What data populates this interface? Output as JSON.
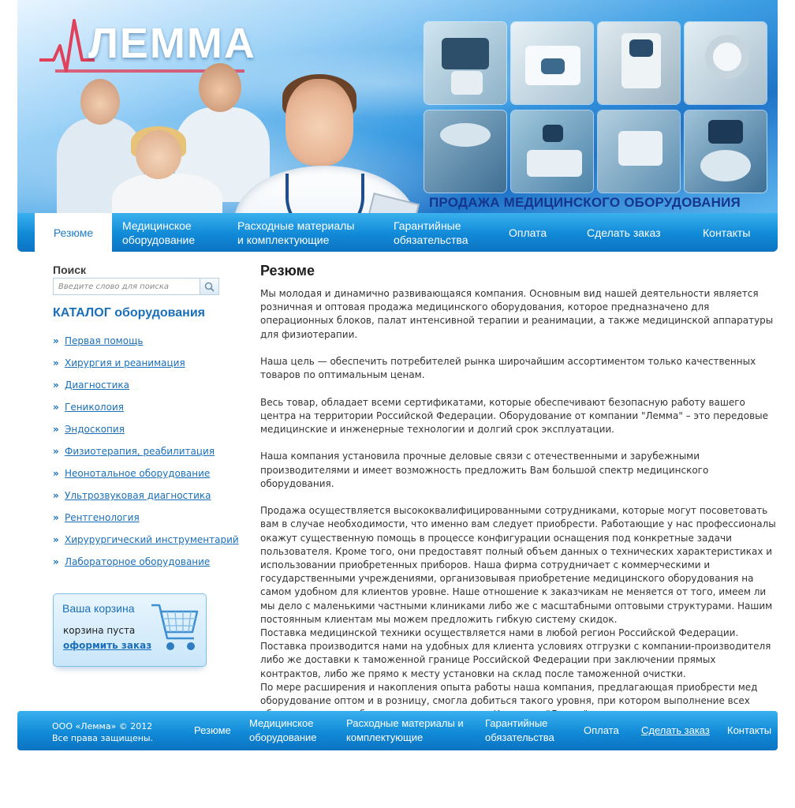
{
  "header": {
    "logo_text": "ЛЕММА",
    "tagline": "ПРОДАЖА МЕДИЦИНСКОГО ОБОРУДОВАНИЯ"
  },
  "nav": {
    "items": [
      {
        "label": "Резюме",
        "active": true
      },
      {
        "label": "Медицинское\nоборудование"
      },
      {
        "label": "Расходные материалы\nи комплектующие"
      },
      {
        "label": "Гарантийные\nобязательства"
      },
      {
        "label": "Оплата"
      },
      {
        "label": "Сделать заказ"
      },
      {
        "label": "Контакты"
      }
    ]
  },
  "sidebar": {
    "search_title": "Поиск",
    "search_placeholder": "Введите слово для поиска",
    "catalog_title": "КАТАЛОГ оборудования",
    "catalog_items": [
      "Первая помощь",
      "Хирургия и реанимация",
      "Диагностика",
      "Гениколоия",
      "Эндоскопия",
      "Физиотерапия, реабилитация",
      "Неонотальное оборудование",
      "Ультрозвуковая диагностика",
      "Рентгенология",
      "Хирурургический инструментарий",
      "Лабораторное оборудование"
    ],
    "cart": {
      "title": "Ваша корзина",
      "status": "корзина пуста",
      "order_link": "оформить заказ"
    }
  },
  "content": {
    "title": "Резюме",
    "paragraphs": [
      "Мы молодая и динамично развивающаяся компания. Основным вид нашей деятельности является розничная и оптовая продажа медицинского оборудования, которое предназначено для операционных блоков, палат интенсивной терапии и реанимации, а также медицинской аппаратуры для физиотерапии.",
      "Наша цель — обеспечить потребителей рынка широчайшим ассортиментом только качественных товаров по оптимальным ценам.",
      "Весь товар, обладает всеми сертификатами, которые обеспечивают безопасную работу вашего центра на территории Российской Федерации. Оборудование от компании \"Лемма\" – это передовые медицинские и инженерные технологии и долгий срок эксплуатации.",
      "Наша компания установила прочные деловые связи с отечественными и зарубежными производителями и имеет возможность предложить Вам большой спектр медицинского оборудования.",
      "Продажа осуществляется высококвалифицированными сотрудниками, которые могут посоветовать вам в случае необходимости, что именно вам следует приобрести. Работающие у нас профессионалы окажут существенную помощь в процессе конфигурации оснащения под конкретные задачи пользователя. Кроме того, они предоставят полный объем данных о технических характеристиках и использовании приобретенных приборов. Наша фирма сотрудничает с коммерческими и государственными учреждениями, организовывая приобретение медицинского оборудования на самом удобном для клиентов уровне. Наше отношение к заказчикам не меняется от того, имеем ли мы дело с маленькими частными клиниками либо же с масштабными оптовыми структурами. Нашим постоянным клиентам мы можем предложить гибкую систему скидок.",
      "Поставка медицинской техники осуществляется нами в любой регион Российской Федерации. Поставка производится нами на удобных для клиента условиях отгрузки с компании-производителя либо же доставки к таможенной границе Российской Федерации при заключении прямых контрактов, либо же прямо к месту установки на склад после таможенной очистки.",
      "По мере расширения и накопления опыта работы наша компания, предлагающая приобрести мед оборудование оптом и в розницу, смогла добиться такого уровня, при котором выполнение всех обязательств – не обуза, а гарант репутации. Компания \"Лемма\" – это надежность, которая проверена временем."
    ]
  },
  "footer": {
    "copyright": "ООО «Лемма» © 2012\nВсе права защищены.",
    "nav": [
      "Резюме",
      "Медицинское\nоборудование",
      "Расходные материалы и\nкомплектующие",
      "Гарантийные\nобязательства",
      "Оплата",
      "Сделать заказ",
      "Контакты"
    ]
  },
  "colors": {
    "accent_blue": "#1a6fb8",
    "nav_blue": "#118ad7",
    "tagline_blue": "#15358f"
  }
}
